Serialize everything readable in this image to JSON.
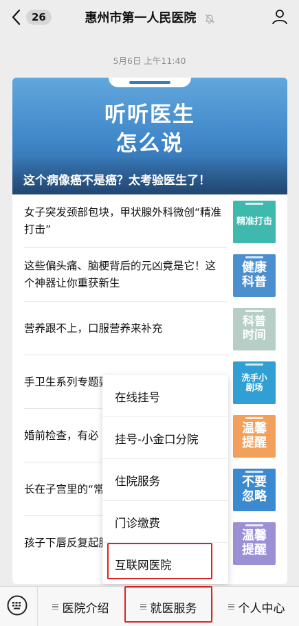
{
  "header": {
    "back_badge": "26",
    "title": "惠州市第一人民医院",
    "icons": [
      "back-chevron-icon",
      "mute-bell-icon",
      "profile-icon"
    ]
  },
  "timestamp": "5月6日 上午11:40",
  "article": {
    "cover_line1": "听听医生",
    "cover_line2": "怎么说",
    "cover_title": "这个病像癌不是癌？太考验医生了！",
    "items": [
      {
        "title": "女子突发颈部包块，甲状腺外科微创“精准打击”",
        "thumb_text": "精准打击",
        "thumb_color": "#3fb8ad"
      },
      {
        "title": "这些偏头痛、脑梗背后的元凶竟是它！这个神器让你重获新生",
        "thumb_text": "健康科普",
        "thumb_color": "#4b8fcf"
      },
      {
        "title": "营养跟不上，口服营养来补充",
        "thumb_text": "科普时间",
        "thumb_color": "#b6cfc6"
      },
      {
        "title": "手卫生系列专题要？",
        "thumb_text": "洗手小剧场",
        "thumb_color": "#2f9fd4"
      },
      {
        "title": "婚前检查，有必",
        "thumb_text": "温馨提醒",
        "thumb_color": "#f2a05a"
      },
      {
        "title": "长在子宫里的“常、不孕！",
        "thumb_text": "不要忽略",
        "thumb_color": "#3b8ad0"
      },
      {
        "title": "孩子下唇反复起肿”",
        "thumb_text": "温馨提醒",
        "thumb_color": "#9b8fd6"
      }
    ]
  },
  "popup_menu": {
    "items": [
      "在线挂号",
      "挂号-小金口分院",
      "住院服务",
      "门诊缴费",
      "互联网医院"
    ],
    "highlight_color": "#e02020"
  },
  "bottom_menu": {
    "tabs": [
      "医院介绍",
      "就医服务",
      "个人中心"
    ]
  }
}
